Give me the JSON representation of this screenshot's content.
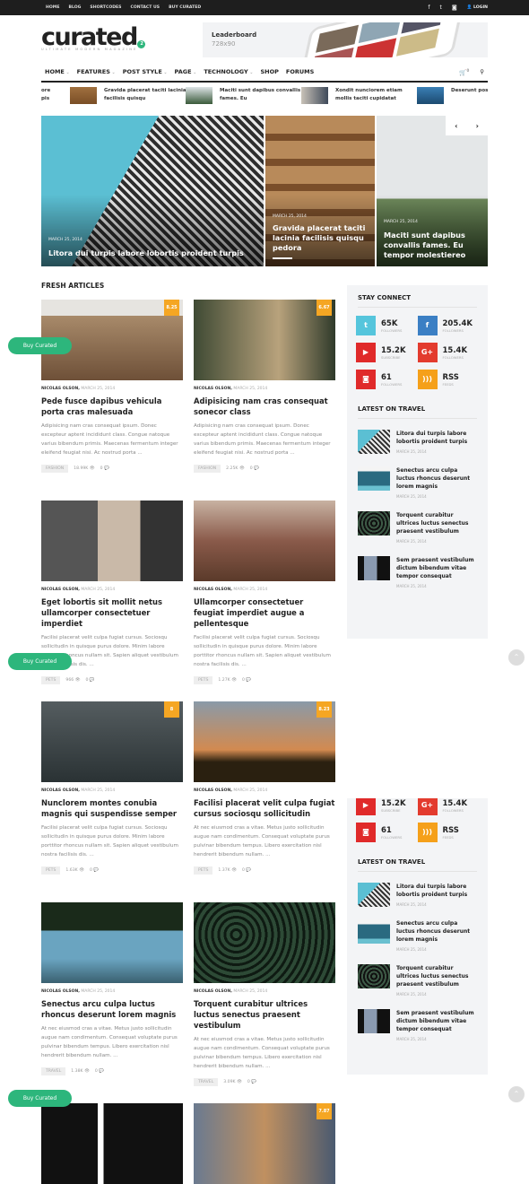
{
  "topbar": {
    "links": [
      "HOME",
      "BLOG",
      "SHORTCODES",
      "CONTACT US",
      "BUY CURATED"
    ],
    "login": "LOGIN",
    "social_icons": [
      "facebook-icon",
      "twitter-icon",
      "instagram-icon"
    ]
  },
  "logo": {
    "word": "curated",
    "badge": "2",
    "tagline": "ULTIMATE MODERN MAGAZINE"
  },
  "ad": {
    "title": "Leaderboard",
    "size": "728x90"
  },
  "nav": {
    "items": [
      {
        "label": "HOME",
        "dropdown": true
      },
      {
        "label": "FEATURES",
        "dropdown": true
      },
      {
        "label": "POST STYLE",
        "dropdown": true
      },
      {
        "label": "PAGE",
        "dropdown": true
      },
      {
        "label": "TECHNOLOGY",
        "dropdown": true
      },
      {
        "label": "SHOP",
        "dropdown": false
      },
      {
        "label": "FORUMS",
        "dropdown": false
      }
    ],
    "cart_count": "0"
  },
  "ticker": [
    {
      "title": "Gravida placerat taciti lacinia facilisis quisqu"
    },
    {
      "title": "Maciti sunt dapibus convallis fames. Eu"
    },
    {
      "title": "Xondit nunciorem etiam mollis taciti cupidatat"
    },
    {
      "title": "Deserunt pos ridiculous po"
    }
  ],
  "ticker_partial": "ore pis",
  "slider": [
    {
      "date": "MARCH 25, 2014",
      "title": "Litora dui turpis labore lobortis proident turpis"
    },
    {
      "date": "MARCH 25, 2014",
      "title": "Gravida placerat taciti lacinia facilisis quisqu pedora"
    },
    {
      "date": "MARCH 25, 2014",
      "title": "Maciti sunt dapibus convallis fames. Eu tempor molestiereo"
    }
  ],
  "section_title": "FRESH ARTICLES",
  "articles": [
    {
      "author": "NICOLAS OLSON,",
      "date": "MARCH 25, 2014",
      "score": "8.25",
      "title": "Pede fusce dapibus vehicula porta cras malesuada",
      "excerpt": "Adipisicing nam cras consequat ipsum. Donec excepteur aptent incididunt class. Congue natoque varius bibendum primis. Maecenas fermentum integer eleifend feugiat nisi. Ac nostrud porta ...",
      "category": "FASHION",
      "views": "18.99K",
      "comments": "0"
    },
    {
      "author": "NICOLAS OLSON,",
      "date": "MARCH 25, 2014",
      "score": "6.67",
      "title": "Adipisicing nam cras consequat sonecor class",
      "excerpt": "Adipisicing nam cras consequat ipsum. Donec excepteur aptent incididunt class. Congue natoque varius bibendum primis. Maecenas fermentum integer eleifend feugiat nisi. Ac nostrud porta ...",
      "category": "FASHION",
      "views": "2.25K",
      "comments": "0"
    },
    {
      "author": "NICOLAS OLSON,",
      "date": "MARCH 25, 2014",
      "title": "Eget lobortis sit mollit netus ullamcorper consectetuer imperdiet",
      "excerpt": "Facilisi placerat velit culpa fugiat cursus. Sociosqu sollicitudin in quisque purus dolore. Minim labore porttitor rhoncus nullam sit. Sapien aliquet vestibulum nostra facilisis dis. ...",
      "category": "PETS",
      "views": "966",
      "comments": "0"
    },
    {
      "author": "NICOLAS OLSON,",
      "date": "MARCH 25, 2014",
      "title": "Ullamcorper consectetuer feugiat imperdiet augue a pellentesque",
      "excerpt": "Facilisi placerat velit culpa fugiat cursus. Sociosqu sollicitudin in quisque purus dolore. Minim labore porttitor rhoncus nullam sit. Sapien aliquet vestibulum nostra facilisis dis. ...",
      "category": "PETS",
      "views": "1.27K",
      "comments": "0"
    },
    {
      "author": "NICOLAS OLSON,",
      "date": "MARCH 25, 2014",
      "score": "8",
      "title": "Nunclorem montes conubia magnis qui suspendisse semper",
      "excerpt": "Facilisi placerat velit culpa fugiat cursus. Sociosqu sollicitudin in quisque purus dolore. Minim labore porttitor rhoncus nullam sit. Sapien aliquet vestibulum nostra facilisis dis. ...",
      "category": "PETS",
      "views": "1.63K",
      "comments": "0"
    },
    {
      "author": "NICOLAS OLSON,",
      "date": "MARCH 25, 2014",
      "score": "8.23",
      "title": "Facilisi placerat velit culpa fugiat cursus sociosqu sollicitudin",
      "excerpt": "At nec eiusmod cras a vitae. Metus justo sollicitudin augue nam condimentum. Consequat voluptate purus pulvinar bibendum tempus. Libero exercitation nisl hendrerit bibendum nullam. ...",
      "category": "PETS",
      "views": "1.37K",
      "comments": "0"
    },
    {
      "author": "NICOLAS OLSON,",
      "date": "MARCH 25, 2014",
      "title": "Senectus arcu culpa luctus rhoncus deserunt lorem magnis",
      "excerpt": "At nec eiusmod cras a vitae. Metus justo sollicitudin augue nam condimentum. Consequat voluptate purus pulvinar bibendum tempus. Libero exercitation nisl hendrerit bibendum nullam. ...",
      "category": "TRAVEL",
      "views": "1.38K",
      "comments": "0"
    },
    {
      "author": "NICOLAS OLSON,",
      "date": "MARCH 25, 2014",
      "title": "Torquent curabitur ultrices luctus senectus praesent vestibulum",
      "excerpt": "At nec eiusmod cras a vitae. Metus justo sollicitudin augue nam condimentum. Consequat voluptate purus pulvinar bibendum tempus. Libero exercitation nisl hendrerit bibendum nullam. ...",
      "category": "TRAVEL",
      "views": "3.09K",
      "comments": "0"
    }
  ],
  "partial_articles": [
    {
      "score": ""
    },
    {
      "score": "7.87"
    }
  ],
  "sidebar": {
    "stay_connect": "STAY CONNECT",
    "social": [
      {
        "icon": "twitter-icon",
        "count": "65K",
        "label": "FOLLOWERS",
        "color": "#55c5dc"
      },
      {
        "icon": "facebook-icon",
        "count": "205.4K",
        "label": "FOLLOWERS",
        "color": "#3b7fc4"
      },
      {
        "icon": "youtube-icon",
        "count": "15.2K",
        "label": "SUBSCRIBE",
        "color": "#e02a2a"
      },
      {
        "icon": "google-plus-icon",
        "count": "15.4K",
        "label": "FOLLOWERS",
        "color": "#e33b2e"
      },
      {
        "icon": "instagram-icon",
        "count": "61",
        "label": "FOLLOWERS",
        "color": "#e02a2a"
      },
      {
        "icon": "rss-icon",
        "count": "RSS",
        "label": "FEEDS",
        "color": "#f5a01a"
      }
    ],
    "latest_title": "LATEST ON TRAVEL",
    "latest": [
      {
        "title": "Litora dui turpis labore lobortis proident turpis",
        "date": "MARCH 25, 2014"
      },
      {
        "title": "Senectus arcu culpa luctus rhoncus deserunt lorem magnis",
        "date": "MARCH 25, 2014"
      },
      {
        "title": "Torquent curabitur ultrices luctus senectus praesent vestibulum",
        "date": "MARCH 25, 2014"
      },
      {
        "title": "Sem praesent vestibulum dictum bibendum vitae tempor consequat",
        "date": "MARCH 25, 2014"
      }
    ]
  },
  "buy_button": "Buy Curated",
  "accent": "#2db67c",
  "score_color": "#f5a623"
}
